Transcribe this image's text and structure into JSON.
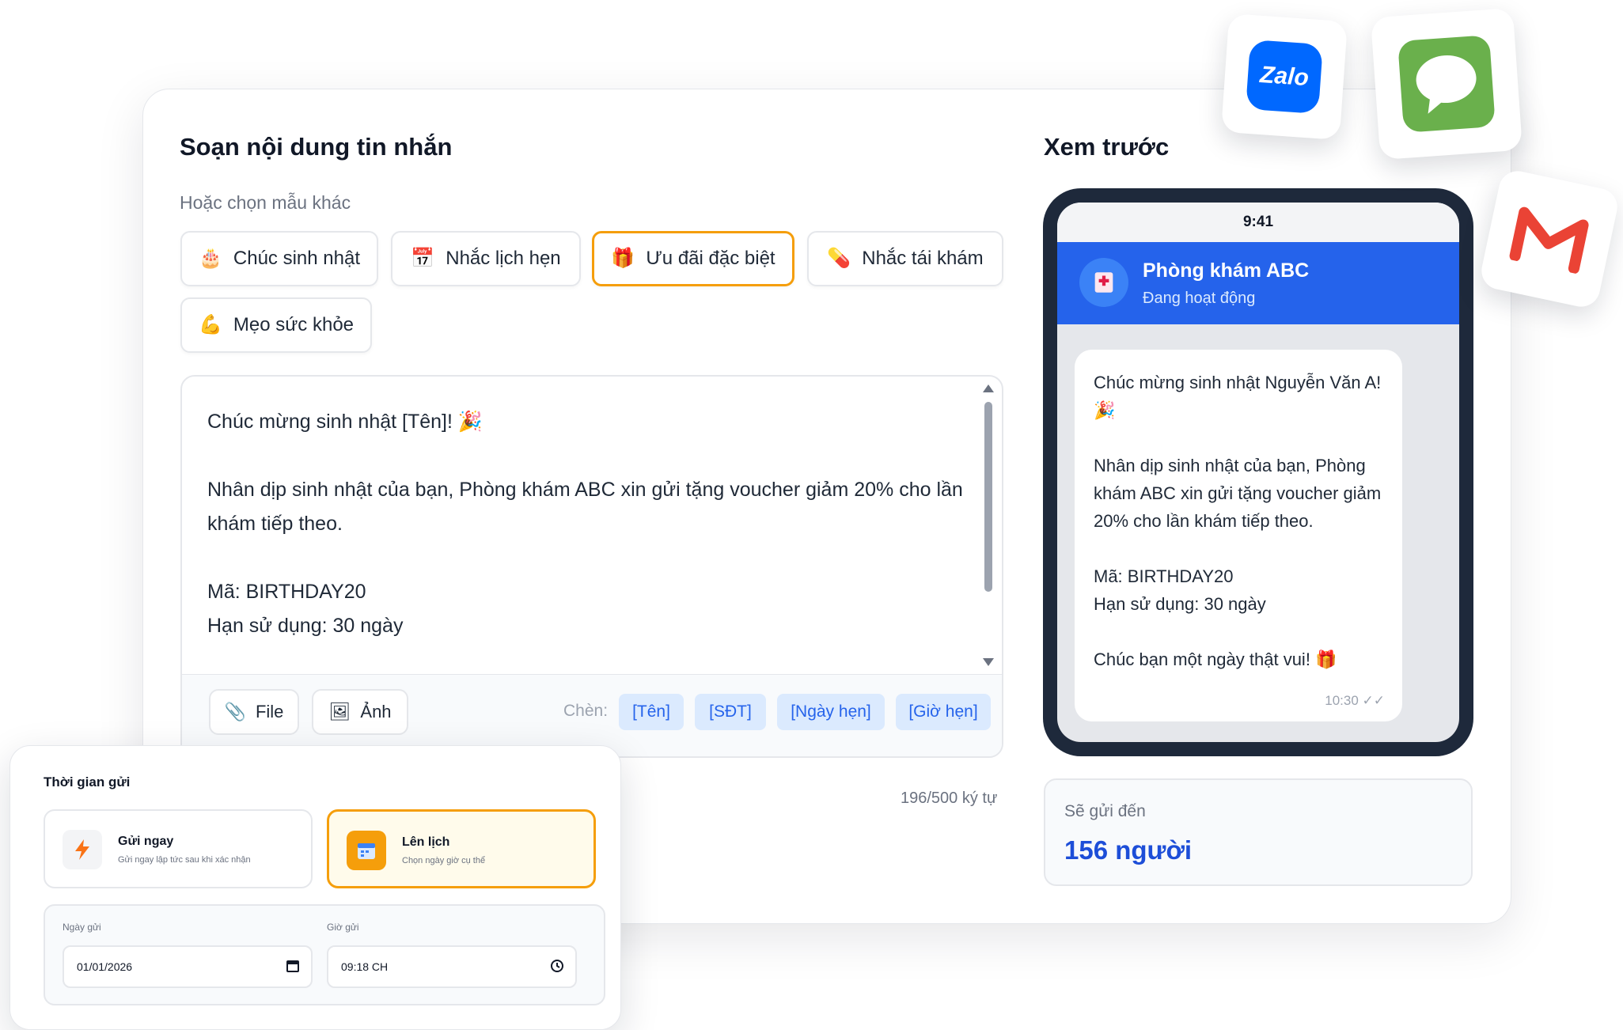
{
  "compose": {
    "title": "Soạn nội dung tin nhắn",
    "template_label": "Hoặc chọn mẫu khác",
    "templates": [
      {
        "label": "Chúc sinh nhật",
        "icon": "cake-icon"
      },
      {
        "label": "Nhắc lịch hẹn",
        "icon": "calendar-icon"
      },
      {
        "label": "Ưu đãi đặc biệt",
        "icon": "gift-icon",
        "active": true
      },
      {
        "label": "Nhắc tái khám",
        "icon": "pill-icon"
      },
      {
        "label": "Mẹo sức khỏe",
        "icon": "muscle-icon"
      }
    ],
    "message_lines": [
      "Chúc mừng sinh nhật [Tên]! 🎉",
      "",
      "Nhân dịp sinh nhật của bạn, Phòng khám ABC xin gửi tặng voucher giảm 20% cho lần khám tiếp theo.",
      "",
      "Mã: BIRTHDAY20",
      "Hạn sử dụng: 30 ngày"
    ],
    "toolbar": {
      "file_label": "File",
      "image_label": "Ảnh",
      "insert_label": "Chèn:",
      "chips": [
        "[Tên]",
        "[SĐT]",
        "[Ngày hẹn]",
        "[Giờ hẹn]"
      ]
    },
    "char_count": "196/500 ký tự"
  },
  "preview": {
    "title": "Xem trước",
    "status_time": "9:41",
    "clinic_name": "Phòng khám ABC",
    "clinic_status": "Đang hoạt động",
    "bubble_lines": [
      "Chúc mừng sinh nhật Nguyễn Văn A! 🎉",
      "",
      "Nhân dịp sinh nhật của bạn, Phòng khám ABC xin gửi tặng voucher giảm 20% cho lần khám tiếp theo.",
      "",
      "Mã: BIRTHDAY20",
      "Hạn sử dụng: 30 ngày",
      "",
      "Chúc bạn một ngày thật vui! 🎁"
    ],
    "bubble_time": "10:30 ✓✓",
    "recipients_label": "Sẽ gửi đến",
    "recipients_count": "156 người"
  },
  "logos": {
    "zalo_text": "Zalo",
    "colors": {
      "zalo": "#0068ff",
      "sms": "#6ab04c",
      "gmail": "#ea4335"
    }
  },
  "schedule": {
    "title": "Thời gian gửi",
    "send_now": {
      "title": "Gửi ngay",
      "subtitle": "Gửi ngay lập tức sau khi xác nhận"
    },
    "schedule": {
      "title": "Lên lịch",
      "subtitle": "Chọn ngày giờ cụ thể"
    },
    "date_label": "Ngày gửi",
    "date_value": "01/01/2026",
    "time_label": "Giờ gửi",
    "time_value": "09:18 CH"
  },
  "colors": {
    "accent": "#f59e0b",
    "primary": "#2563eb",
    "phone_frame": "#1e293b"
  }
}
